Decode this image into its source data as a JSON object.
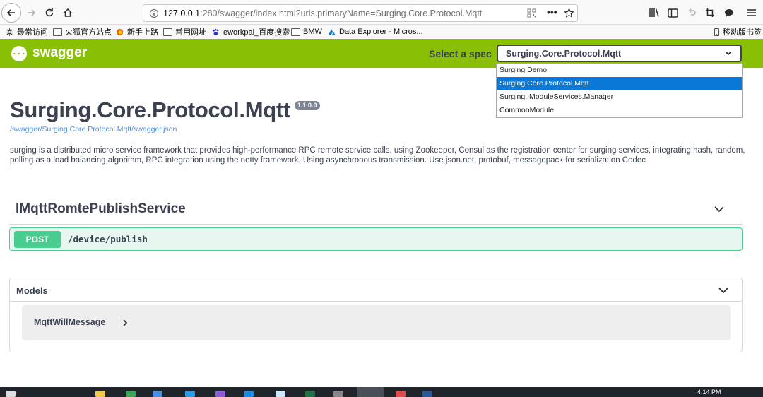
{
  "browser": {
    "url_host": "127.0.0.1",
    "url_rest": ":280/swagger/index.html?urls.primaryName=Surging.Core.Protocol.Mqtt"
  },
  "bookmarks": {
    "items": [
      {
        "label": "最常访问",
        "icon": "gear-icon"
      },
      {
        "label": "火狐官方站点",
        "icon": "folder-icon"
      },
      {
        "label": "新手上路",
        "icon": "firefox-icon"
      },
      {
        "label": "常用网址",
        "icon": "folder-icon"
      },
      {
        "label": "eworkpal_百度搜索",
        "icon": "baidu-icon"
      },
      {
        "label": "BMW",
        "icon": "folder-icon"
      },
      {
        "label": "Data Explorer - Micros...",
        "icon": "azure-icon"
      }
    ],
    "mobile_label": "移动版书签"
  },
  "swagger": {
    "logo_text": "swagger",
    "logo_icon_glyph": "{···}",
    "spec_label": "Select a spec",
    "spec_selected": "Surging.Core.Protocol.Mqtt",
    "spec_options": [
      "Surging Demo",
      "Surging.Core.Protocol.Mqtt",
      "Surging.IModuleServices.Manager",
      "CommonModule"
    ],
    "accent_color": "#89bf04"
  },
  "info": {
    "title": "Surging.Core.Protocol.Mqtt",
    "version": "1.1.0.0",
    "spec_url": "/swagger/Surging.Core.Protocol.Mqtt/swagger.json",
    "description": "surging is a distributed micro service framework that provides high-performance RPC remote service calls, using Zookeeper, Consul as the registration center for surging services, integrating hash, random, polling as a load balancing algorithm, RPC integration using the netty framework, Using asynchronous transmission. Use json.net, protobuf, messagepack for serialization Codec"
  },
  "tag": {
    "name": "IMqttRomtePublishService",
    "operation": {
      "method": "POST",
      "path": "/device/publish",
      "method_color": "#49cc90"
    }
  },
  "models": {
    "title": "Models",
    "items": [
      {
        "name": "MqttWillMessage"
      }
    ]
  },
  "taskbar": {
    "time": "4:14 PM"
  }
}
